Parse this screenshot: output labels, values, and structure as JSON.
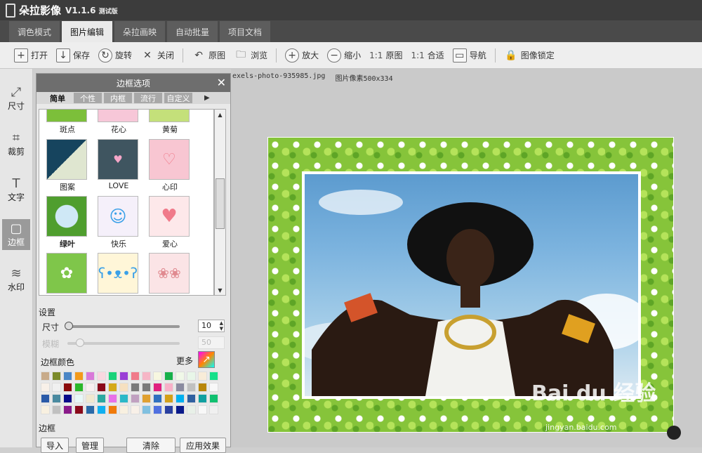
{
  "app": {
    "name": "朵拉影像",
    "version": "V1.1.6",
    "version_note": "测试版"
  },
  "tabs": [
    {
      "label": "调色模式",
      "active": false
    },
    {
      "label": "图片编辑",
      "active": true
    },
    {
      "label": "朵拉画映",
      "active": false
    },
    {
      "label": "自动批量",
      "active": false
    },
    {
      "label": "项目文档",
      "active": false
    }
  ],
  "toolbar": {
    "open": "打开",
    "save": "保存",
    "rotate": "旋转",
    "close": "关闭",
    "original": "原图",
    "browse": "浏览",
    "zoom_in": "放大",
    "zoom_out": "缩小",
    "ratio_prefix_1": "1:1",
    "ratio_original": "原图",
    "ratio_prefix_2": "1:1",
    "ratio_fit": "合适",
    "navigate": "导航",
    "lock": "图像锁定"
  },
  "sidebar": [
    {
      "label": "尺寸",
      "icon": "resize-icon",
      "active": false
    },
    {
      "label": "裁剪",
      "icon": "crop-icon",
      "active": false
    },
    {
      "label": "文字",
      "icon": "text-icon",
      "active": false
    },
    {
      "label": "边框",
      "icon": "frame-icon",
      "active": true
    },
    {
      "label": "水印",
      "icon": "watermark-icon",
      "active": false
    }
  ],
  "panel": {
    "title": "边框选项",
    "subtabs": [
      {
        "label": "简单",
        "active": true
      },
      {
        "label": "个性",
        "active": false
      },
      {
        "label": "内框",
        "active": false
      },
      {
        "label": "流行",
        "active": false
      },
      {
        "label": "自定义",
        "active": false
      }
    ],
    "frames": [
      {
        "label": "斑点",
        "color": "#7cbf3a"
      },
      {
        "label": "花心",
        "color": "#f7c7d8"
      },
      {
        "label": "黄菊",
        "color": "#c4e07a"
      },
      {
        "label": "图案",
        "color": "#16445e"
      },
      {
        "label": "LOVE",
        "color": "#3f5560"
      },
      {
        "label": "心印",
        "color": "#f8c6d2"
      },
      {
        "label": "绿叶",
        "color": "#4f9e2e",
        "selected": true
      },
      {
        "label": "快乐",
        "color": "#c8a6e8"
      },
      {
        "label": "爱心",
        "color": "#f08090"
      },
      {
        "label": "",
        "color": "#7fc64a"
      },
      {
        "label": "",
        "color": "#a8d4f3"
      },
      {
        "label": "",
        "color": "#f2b7bf"
      }
    ],
    "settings_label": "设置",
    "size_label": "尺寸",
    "size_value": "10",
    "size_fraction": 0.0,
    "blur_label": "模糊",
    "blur_value": "50",
    "color_label": "边框颜色",
    "more_label": "更多",
    "swatches": [
      "#c8ab8a",
      "#7a8a2a",
      "#4a86c6",
      "#f39a1a",
      "#d979d9",
      "#f8d8e0",
      "#19d37a",
      "#9a3fd6",
      "#f07a8a",
      "#f6b6c6",
      "#f7f7e0",
      "#17b04a",
      "#f0f8e8",
      "#e8f6e8",
      "#f8ecd8",
      "#16e08a",
      "#f8f0e8",
      "#f0f0f0",
      "#8a0a0a",
      "#2ab82a",
      "#f8f0f0",
      "#8a0a1a",
      "#d4aa1a",
      "#f6e0c0",
      "#7a7a7a",
      "#7a7a7a",
      "#e02080",
      "#f8b0c8",
      "#8a8aa0",
      "#c0c0c0",
      "#b8860b",
      "#f8f8f8",
      "#2a5aa8",
      "#4a8aa0",
      "#0a0a8a",
      "#e8f8f8",
      "#f0e8d0",
      "#2aa8a0",
      "#e870e8",
      "#2ab8c8",
      "#c0a0c0",
      "#e0a030",
      "#3070c0",
      "#d4a018",
      "#00b0f0",
      "#3060a0",
      "#10a0a0",
      "#10c070",
      "#f8f0e0",
      "#c0c0c0",
      "#8a1a8a",
      "#8a0a1a",
      "#2a6aa8",
      "#10b0f0",
      "#f07a0a",
      "#f8f0e0",
      "#f8f0e8",
      "#80c0e0",
      "#5070e0",
      "#2a40a0",
      "#0a1a8a",
      "#e8f0e8",
      "#f8f8f8",
      "#f0f0f0"
    ],
    "border_label": "边框",
    "btn_import": "导入",
    "btn_manage": "管理",
    "btn_clear": "清除",
    "btn_apply": "应用效果"
  },
  "canvas": {
    "filename": "exels-photo-935985.jpg",
    "pixels": "图片像素500x334"
  },
  "watermark": {
    "text": "Bai du 经验",
    "sub": "jingyan.baidu.com"
  }
}
